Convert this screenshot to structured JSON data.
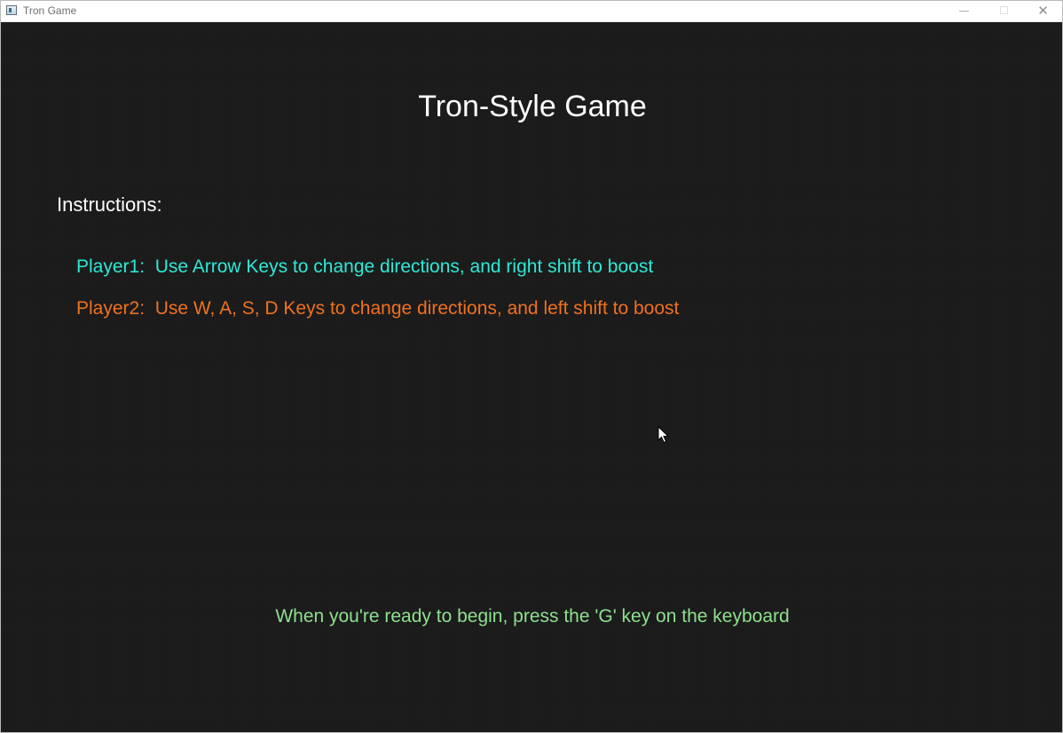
{
  "window": {
    "title": "Tron Game",
    "controls": {
      "minimize": "—",
      "maximize": "☐",
      "close": "✕"
    }
  },
  "game": {
    "title": "Tron-Style Game",
    "instructions_heading": "Instructions:",
    "players": [
      {
        "label": "Player1:",
        "instruction": "Use Arrow Keys to change directions, and right shift to boost",
        "color": "#2ee8d6"
      },
      {
        "label": "Player2:",
        "instruction": "Use W, A, S, D Keys to change directions, and left shift to boost",
        "color": "#f0711e"
      }
    ],
    "ready_prompt": "When you're ready to begin, press the 'G' key on the keyboard",
    "ready_prompt_color": "#8ee08e",
    "background_color": "#1b1b1b"
  },
  "icons": {
    "app": "window-app-icon",
    "cursor": "mouse-pointer-icon"
  }
}
